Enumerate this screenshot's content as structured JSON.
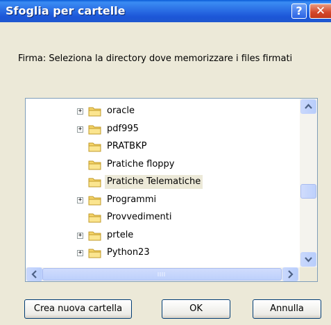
{
  "window": {
    "title": "Sfoglia per cartelle",
    "help_label": "?",
    "close_label": "✕"
  },
  "prompt": "Firma: Seleziona la directory dove memorizzare i files firmati",
  "tree": {
    "items": [
      {
        "label": "oracle",
        "expandable": true,
        "selected": false
      },
      {
        "label": "pdf995",
        "expandable": true,
        "selected": false
      },
      {
        "label": "PRATBKP",
        "expandable": false,
        "selected": false
      },
      {
        "label": "Pratiche floppy",
        "expandable": false,
        "selected": false
      },
      {
        "label": "Pratiche Telematiche",
        "expandable": false,
        "selected": true
      },
      {
        "label": "Programmi",
        "expandable": true,
        "selected": false
      },
      {
        "label": "Provvedimenti",
        "expandable": false,
        "selected": false
      },
      {
        "label": "prtele",
        "expandable": true,
        "selected": false
      },
      {
        "label": "Python23",
        "expandable": true,
        "selected": false
      }
    ],
    "expand_glyph": "+"
  },
  "buttons": {
    "new_folder": "Crea nuova cartella",
    "ok": "OK",
    "cancel": "Annulla"
  },
  "colors": {
    "titlebar": "#2b6fe5",
    "folder_fill": "#f5d468",
    "folder_stroke": "#c19a2a",
    "selected_bg": "#ece9d8"
  }
}
